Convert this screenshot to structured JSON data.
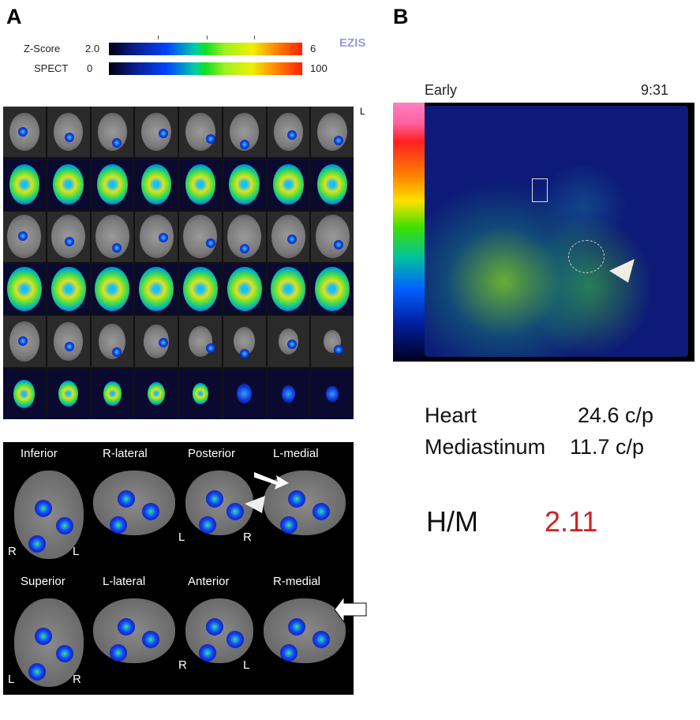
{
  "panel_a": {
    "letter": "A",
    "colorbars": {
      "zscore": {
        "label": "Z-Score",
        "min": "2.0",
        "max": "6"
      },
      "spect": {
        "label": "SPECT",
        "min": "0",
        "max": "100"
      },
      "brand": "EZIS"
    },
    "side_marker": "L",
    "surface_views": [
      {
        "label": "Inferior",
        "left": "R",
        "right": "L"
      },
      {
        "label": "R-lateral"
      },
      {
        "label": "Posterior",
        "left": "L",
        "right": "R"
      },
      {
        "label": "L-medial"
      },
      {
        "label": "Superior",
        "left": "L",
        "right": "R"
      },
      {
        "label": "L-lateral"
      },
      {
        "label": "Anterior",
        "left": "R",
        "right": "L"
      },
      {
        "label": "R-medial"
      }
    ]
  },
  "panel_b": {
    "letter": "B",
    "phase": "Early",
    "time": "9:31",
    "heart": {
      "label": "Heart",
      "value": "24.6 c/p"
    },
    "mediastinum": {
      "label": "Mediastinum",
      "value": "11.7 c/p"
    },
    "ratio": {
      "label": "H/M",
      "value": "2.11",
      "color": "#cc2222"
    }
  }
}
